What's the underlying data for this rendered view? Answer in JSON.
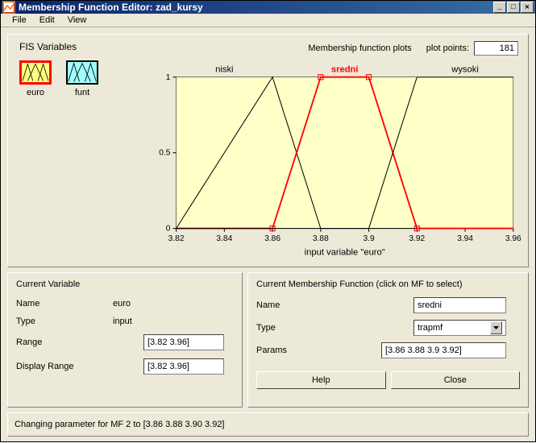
{
  "window": {
    "title": "Membership Function Editor: zad_kursy"
  },
  "menu": {
    "file": "File",
    "edit": "Edit",
    "view": "View"
  },
  "fis": {
    "label": "FIS Variables",
    "vars": [
      {
        "name": "euro",
        "selected": true
      },
      {
        "name": "funt",
        "selected": false
      }
    ]
  },
  "plot_header": {
    "mf_label": "Membership function plots",
    "pp_label": "plot points:",
    "pp_value": "181"
  },
  "chart_data": {
    "type": "line",
    "xlabel": "input variable \"euro\"",
    "xlim": [
      3.82,
      3.96
    ],
    "ylim": [
      0,
      1
    ],
    "xticks": [
      3.82,
      3.84,
      3.86,
      3.88,
      3.9,
      3.92,
      3.94,
      3.96
    ],
    "yticks": [
      0,
      0.5,
      1
    ],
    "series": [
      {
        "name": "niski",
        "type": "trapmf",
        "params": [
          3.82,
          3.82,
          3.86,
          3.88
        ],
        "color": "#000",
        "selected": false
      },
      {
        "name": "sredni",
        "type": "trapmf",
        "params": [
          3.86,
          3.88,
          3.9,
          3.92
        ],
        "color": "#f00",
        "selected": true
      },
      {
        "name": "wysoki",
        "type": "trapmf",
        "params": [
          3.9,
          3.92,
          3.96,
          3.96
        ],
        "color": "#000",
        "selected": false
      }
    ]
  },
  "current_var": {
    "title": "Current Variable",
    "name_label": "Name",
    "name": "euro",
    "type_label": "Type",
    "type": "input",
    "range_label": "Range",
    "range": "[3.82 3.96]",
    "disp_label": "Display Range",
    "disp_range": "[3.82 3.96]"
  },
  "current_mf": {
    "title": "Current Membership Function (click on MF to select)",
    "name_label": "Name",
    "name": "sredni",
    "type_label": "Type",
    "type": "trapmf",
    "params_label": "Params",
    "params": "[3.86 3.88 3.9 3.92]",
    "help": "Help",
    "close": "Close"
  },
  "status": "Changing parameter for MF 2 to  [3.86 3.88 3.90 3.92]"
}
